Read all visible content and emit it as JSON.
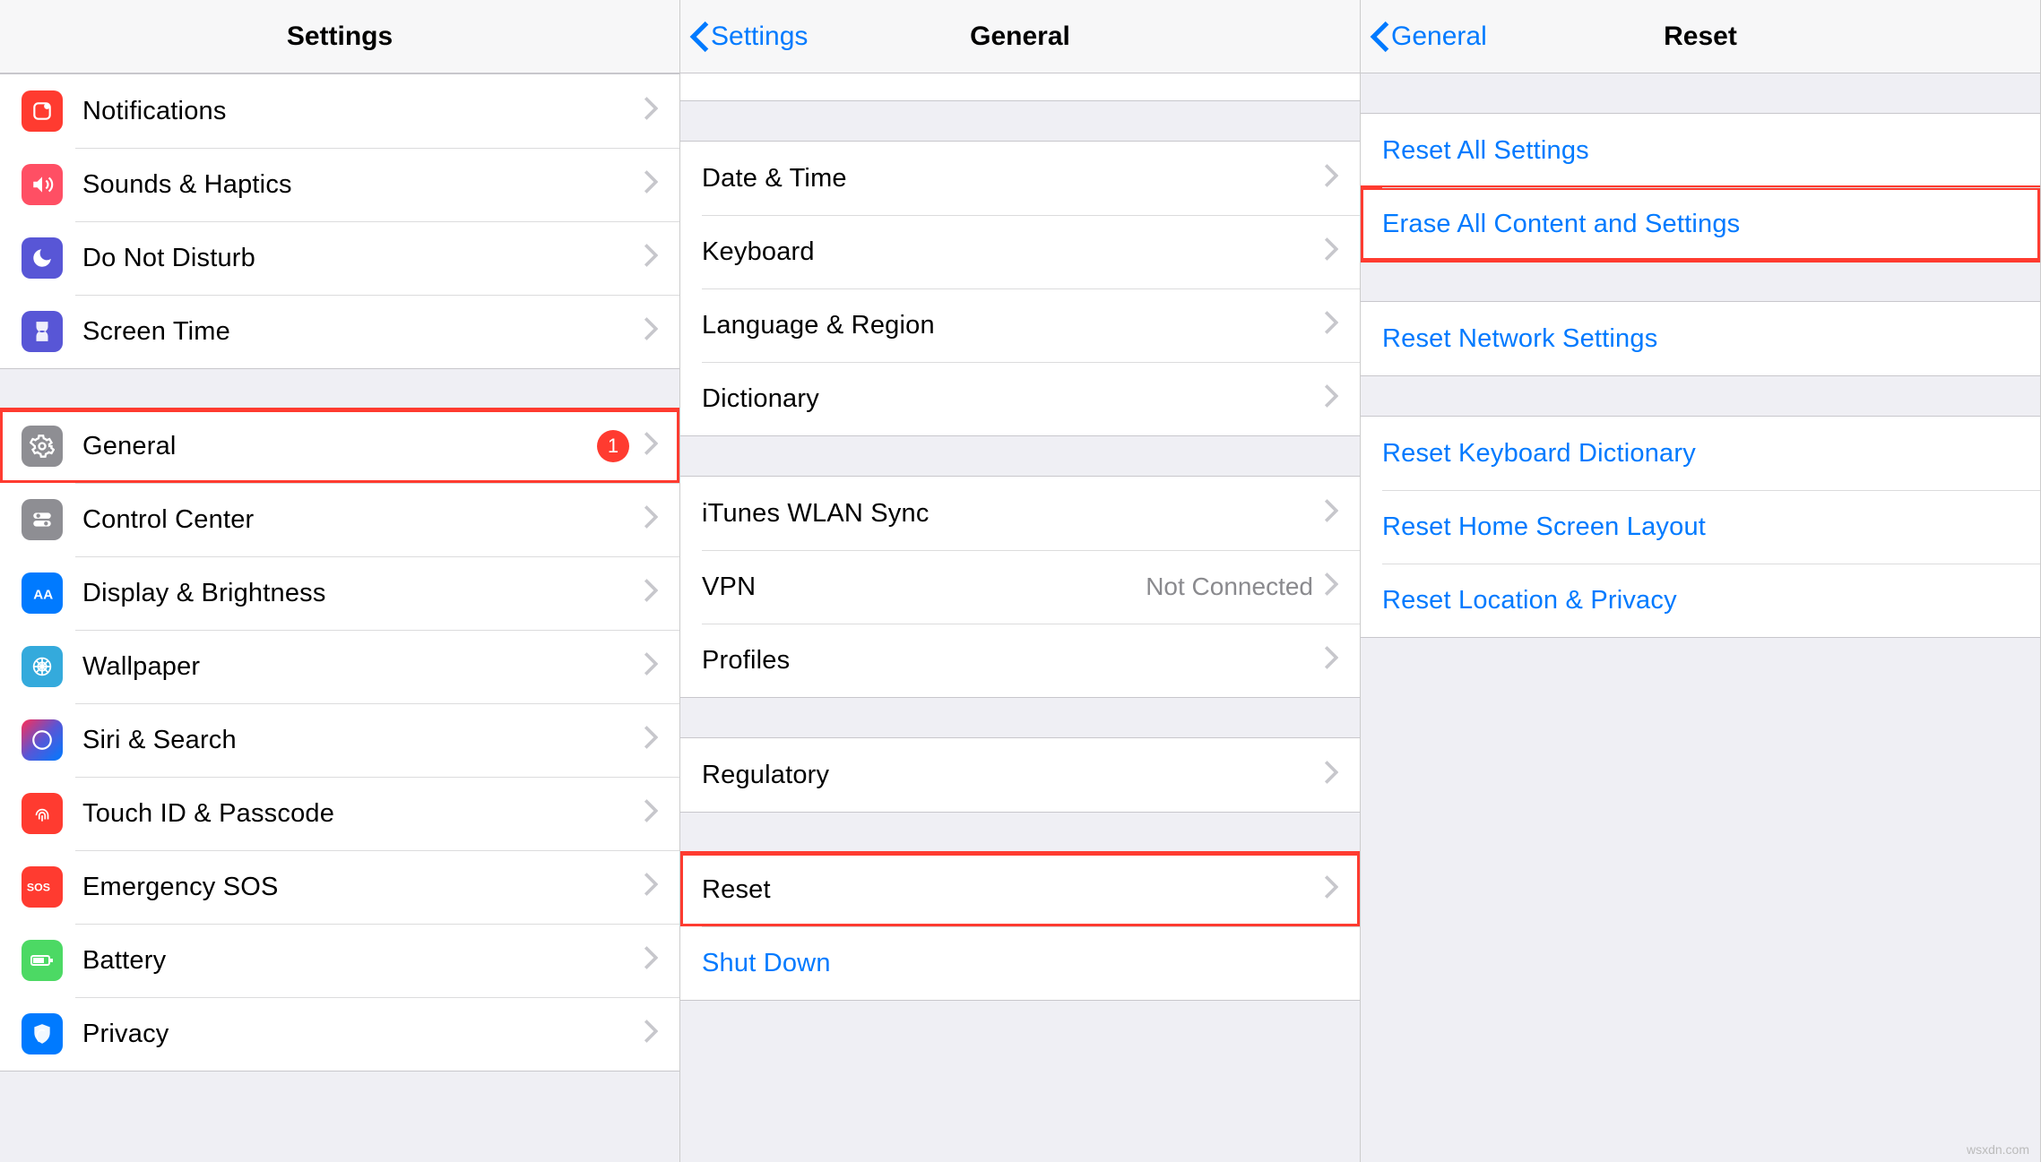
{
  "panel1": {
    "title": "Settings",
    "group1": [
      {
        "icon": "notifications-icon",
        "label": "Notifications"
      },
      {
        "icon": "sounds-icon",
        "label": "Sounds & Haptics"
      },
      {
        "icon": "dnd-icon",
        "label": "Do Not Disturb"
      },
      {
        "icon": "screentime-icon",
        "label": "Screen Time"
      }
    ],
    "group2": [
      {
        "icon": "general-icon",
        "label": "General",
        "badge": "1",
        "highlight": true
      },
      {
        "icon": "control-center-icon",
        "label": "Control Center"
      },
      {
        "icon": "display-icon",
        "label": "Display & Brightness"
      },
      {
        "icon": "wallpaper-icon",
        "label": "Wallpaper"
      },
      {
        "icon": "siri-icon",
        "label": "Siri & Search"
      },
      {
        "icon": "touchid-icon",
        "label": "Touch ID & Passcode"
      },
      {
        "icon": "sos-icon",
        "label": "Emergency SOS"
      },
      {
        "icon": "battery-icon",
        "label": "Battery"
      },
      {
        "icon": "privacy-icon",
        "label": "Privacy"
      }
    ]
  },
  "panel2": {
    "back": "Settings",
    "title": "General",
    "group1": [
      {
        "label": "Date & Time"
      },
      {
        "label": "Keyboard"
      },
      {
        "label": "Language & Region"
      },
      {
        "label": "Dictionary"
      }
    ],
    "group2": [
      {
        "label": "iTunes WLAN Sync"
      },
      {
        "label": "VPN",
        "detail": "Not Connected"
      },
      {
        "label": "Profiles"
      }
    ],
    "group3": [
      {
        "label": "Regulatory"
      }
    ],
    "group4": [
      {
        "label": "Reset",
        "highlight": true
      },
      {
        "label": "Shut Down",
        "link": true,
        "noChevron": true
      }
    ]
  },
  "panel3": {
    "back": "General",
    "title": "Reset",
    "group1": [
      {
        "label": "Reset All Settings"
      },
      {
        "label": "Erase All Content and Settings",
        "highlight": true
      }
    ],
    "group2": [
      {
        "label": "Reset Network Settings"
      }
    ],
    "group3": [
      {
        "label": "Reset Keyboard Dictionary"
      },
      {
        "label": "Reset Home Screen Layout"
      },
      {
        "label": "Reset Location & Privacy"
      }
    ]
  },
  "watermark": "wsxdn.com"
}
